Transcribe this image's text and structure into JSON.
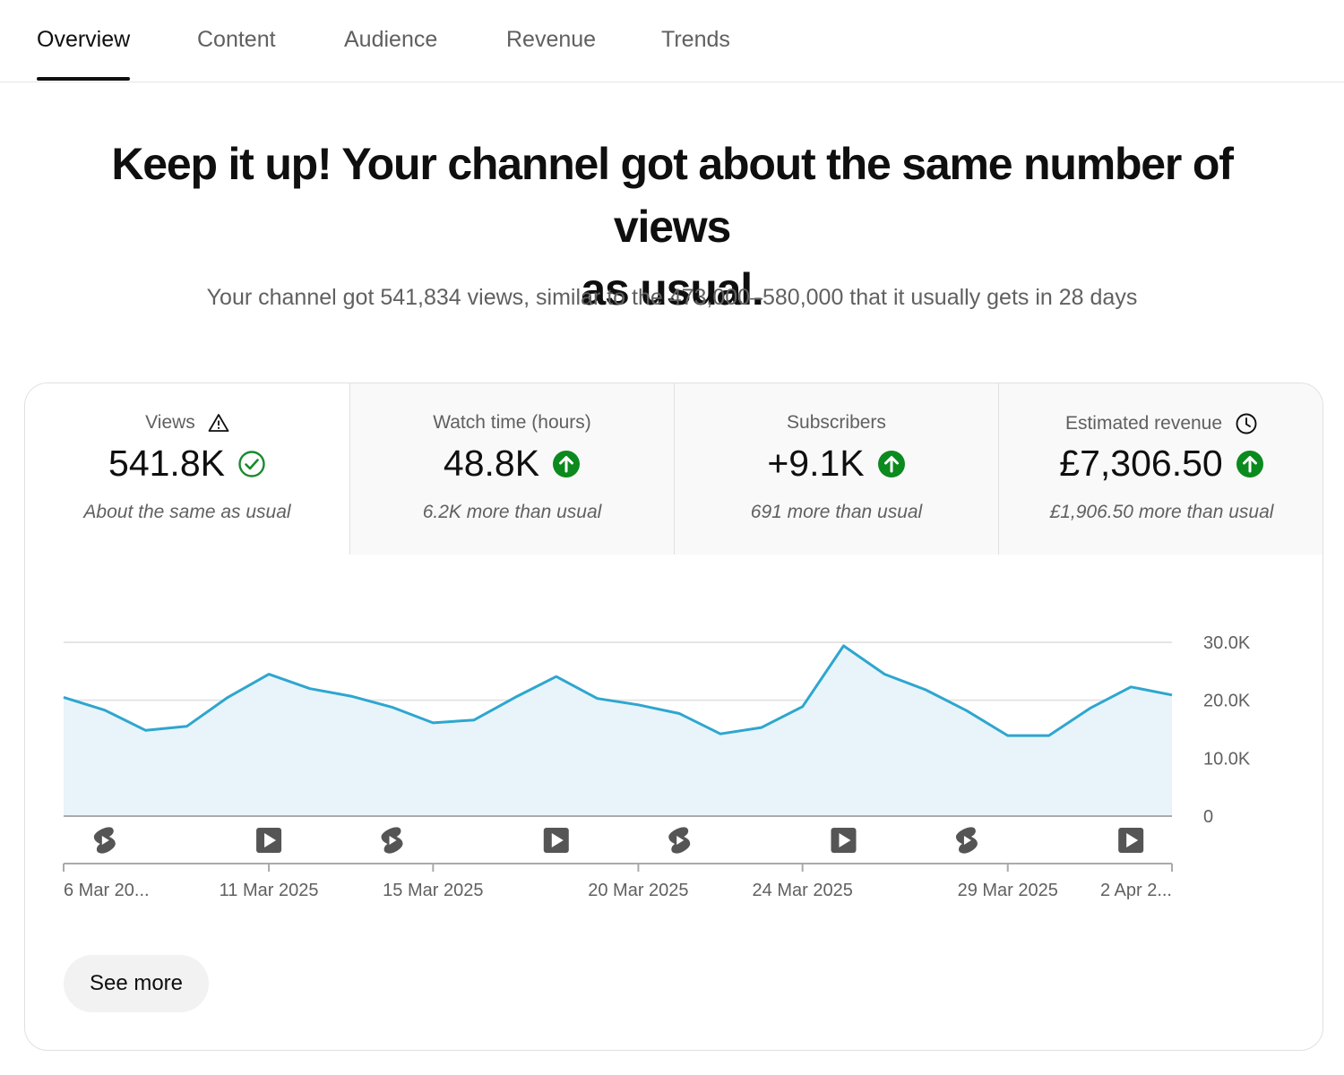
{
  "tabs": [
    {
      "label": "Overview",
      "active": true
    },
    {
      "label": "Content",
      "active": false
    },
    {
      "label": "Audience",
      "active": false
    },
    {
      "label": "Revenue",
      "active": false
    },
    {
      "label": "Trends",
      "active": false
    }
  ],
  "headline": {
    "line1": "Keep it up! Your channel got about the same number of views",
    "line2": "as usual."
  },
  "subline": "Your channel got 541,834 views, similar to the 473,000–580,000 that it usually gets in 28 days",
  "metrics": [
    {
      "label": "Views",
      "value": "541.8K",
      "note": "About the same as usual",
      "status_icon": "check-circle-icon",
      "label_icon": "warning-icon",
      "selected": true
    },
    {
      "label": "Watch time (hours)",
      "value": "48.8K",
      "note": "6.2K more than usual",
      "status_icon": "arrow-up-circle-icon",
      "selected": false
    },
    {
      "label": "Subscribers",
      "value": "+9.1K",
      "note": "691 more than usual",
      "status_icon": "arrow-up-circle-icon",
      "selected": false
    },
    {
      "label": "Estimated revenue",
      "value": "£7,306.50",
      "note": "£1,906.50 more than usual",
      "status_icon": "arrow-up-circle-icon",
      "label_icon": "clock-icon",
      "selected": false
    }
  ],
  "colors": {
    "line": "#2ea6cf",
    "area": "#e8f4fa",
    "up_green": "#0b8a1e",
    "check_green": "#1a8a2e"
  },
  "chart_data": {
    "type": "area",
    "series": [
      {
        "values": [
          20500,
          18300,
          14800,
          15500,
          20500,
          24500,
          22000,
          20700,
          18800,
          16100,
          16600,
          20500,
          24100,
          20300,
          19200,
          17700,
          14200,
          15300,
          18900,
          29400,
          24500,
          21800,
          18200,
          13900,
          13900,
          18600,
          22300,
          20900
        ]
      }
    ],
    "ylim": [
      0,
      30000
    ],
    "y_ticks": [
      "30.0K",
      "20.0K",
      "10.0K",
      "0"
    ],
    "y_tick_values": [
      30000,
      20000,
      10000,
      0
    ],
    "x_tick_labels": [
      "6 Mar 20...",
      "11 Mar 2025",
      "15 Mar 2025",
      "20 Mar 2025",
      "24 Mar 2025",
      "29 Mar 2025",
      "2 Apr 2..."
    ],
    "x_tick_indices": [
      0,
      5,
      9,
      14,
      18,
      23,
      27
    ],
    "uploads": [
      {
        "type": "short",
        "index": 1
      },
      {
        "type": "video",
        "index": 5
      },
      {
        "type": "short",
        "index": 8
      },
      {
        "type": "video",
        "index": 12
      },
      {
        "type": "short",
        "index": 15
      },
      {
        "type": "video",
        "index": 19
      },
      {
        "type": "short",
        "index": 22
      },
      {
        "type": "video",
        "index": 26
      }
    ],
    "grid": true,
    "y_axis_position": "right"
  },
  "see_more_label": "See more"
}
